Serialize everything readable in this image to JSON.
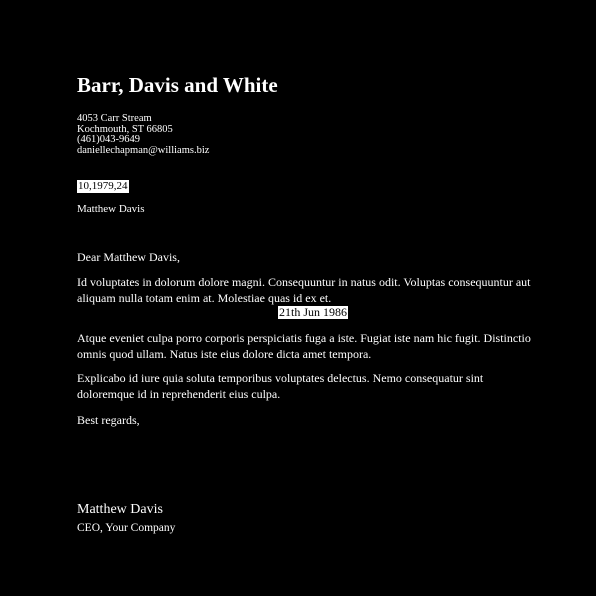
{
  "letter": {
    "company": "Barr, Davis and White",
    "address": {
      "street": "4053 Carr Stream",
      "city_line": "Kochmouth, ST 66805",
      "phone": "(461)043-9649",
      "email": "daniellechapman@williams.biz"
    },
    "reference": "10,1979,24",
    "recipient": "Matthew Davis",
    "salutation": "Dear Matthew Davis,",
    "paragraphs": [
      "Id voluptates in dolorum dolore magni. Consequuntur in natus odit. Voluptas consequuntur aut aliquam nulla totam enim at. Molestiae quas id ex et.",
      "Atque eveniet culpa porro corporis perspiciatis fuga a iste. Fugiat iste nam hic fugit. Distinctio omnis quod ullam. Natus iste eius dolore dicta amet tempora.",
      "Explicabo id iure quia soluta temporibus voluptates delectus. Nemo consequatur sint doloremque id in reprehenderit eius culpa."
    ],
    "date": "21th Jun 1986",
    "closing": "Best regards,",
    "signature": {
      "name": "Matthew Davis",
      "title": "CEO, Your Company"
    }
  },
  "colors": {
    "background": "#000000",
    "text": "#ffffff",
    "highlight_bg": "#ffffff",
    "highlight_text": "#000000"
  }
}
